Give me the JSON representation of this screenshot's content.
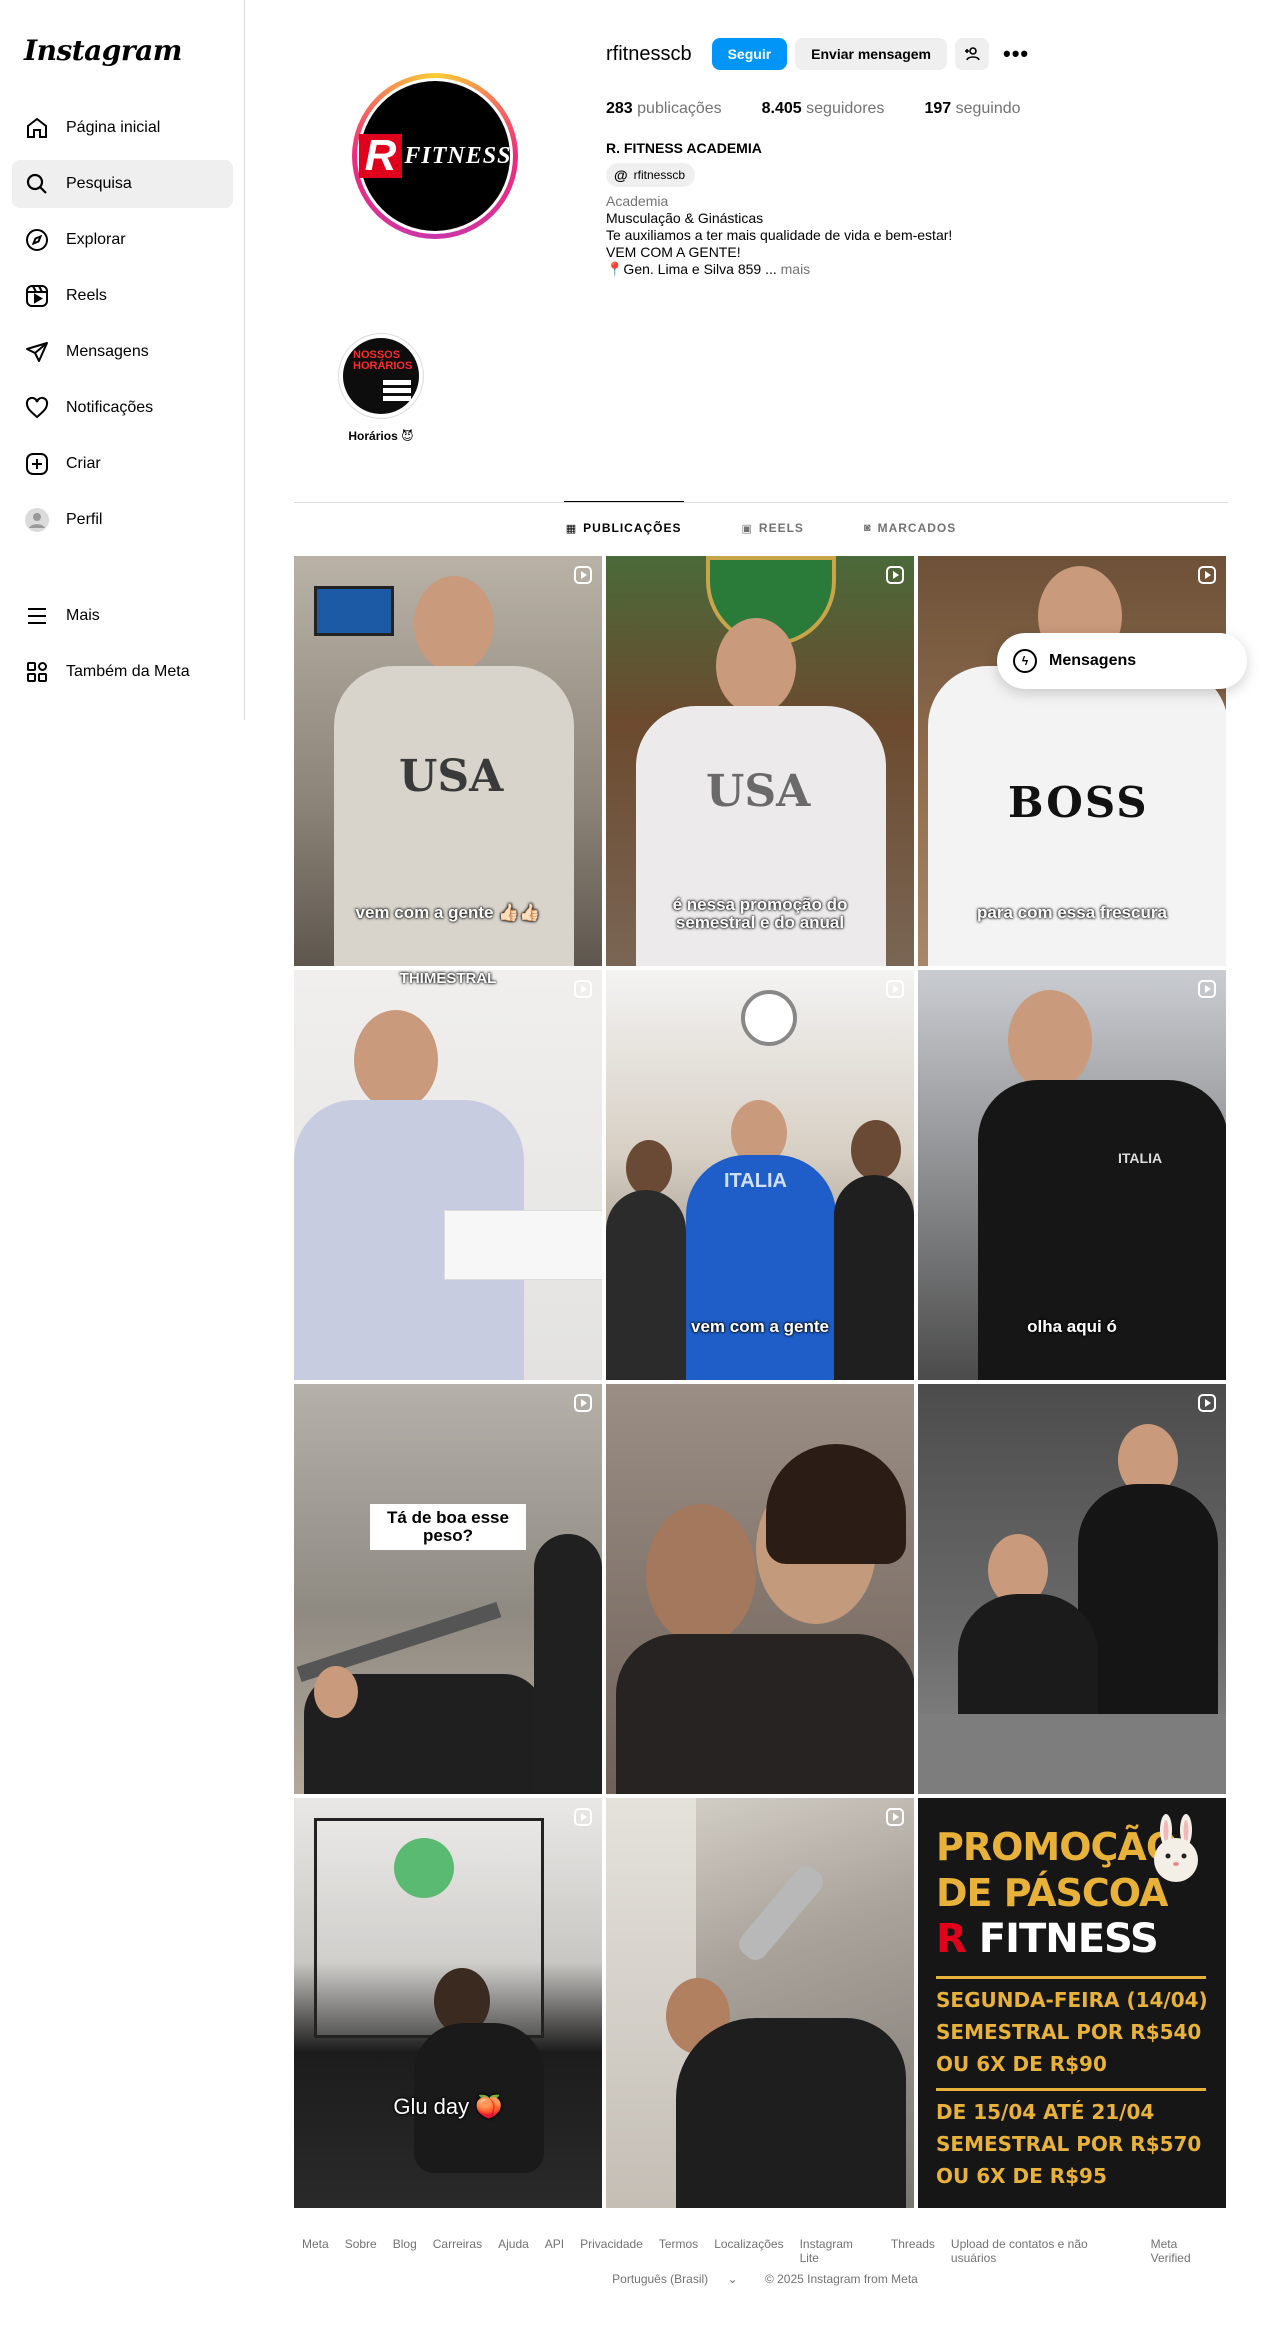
{
  "app": {
    "logo": "Instagram"
  },
  "sidebar": {
    "items": [
      {
        "label": "Página inicial",
        "icon": "home-icon"
      },
      {
        "label": "Pesquisa",
        "icon": "search-icon"
      },
      {
        "label": "Explorar",
        "icon": "compass-icon"
      },
      {
        "label": "Reels",
        "icon": "reels-icon"
      },
      {
        "label": "Mensagens",
        "icon": "paper-plane-icon"
      },
      {
        "label": "Notificações",
        "icon": "heart-icon"
      },
      {
        "label": "Criar",
        "icon": "plus-square-icon"
      },
      {
        "label": "Perfil",
        "icon": "avatar-icon"
      }
    ],
    "bottom": [
      {
        "label": "Mais",
        "icon": "menu-icon"
      },
      {
        "label": "Também da Meta",
        "icon": "meta-apps-icon"
      }
    ]
  },
  "profile": {
    "username": "rfitnesscb",
    "follow_label": "Seguir",
    "message_label": "Enviar mensagem",
    "avatar_r": "R",
    "avatar_text": "FITNESS",
    "stats": {
      "posts": "283",
      "posts_label": "publicações",
      "followers": "8.405",
      "followers_label": "seguidores",
      "following": "197",
      "following_label": "seguindo"
    },
    "full_name": "R. FITNESS ACADEMIA",
    "threads_handle": "rfitnesscb",
    "category": "Academia",
    "bio_lines": [
      "Musculação & Ginásticas",
      "Te auxiliamos a ter mais qualidade de vida e bem-estar!",
      "VEM COM A GENTE!",
      "📍Gen. Lima e Silva 859 ..."
    ],
    "more_label": "mais"
  },
  "highlight": {
    "label": "Horários 😈",
    "cover_text": "NOSSOS HORÁRIOS"
  },
  "tabs": [
    {
      "label": "PUBLICAÇÕES",
      "icon": "grid-icon"
    },
    {
      "label": "REELS",
      "icon": "reels-icon"
    },
    {
      "label": "MARCADOS",
      "icon": "tagged-icon"
    }
  ],
  "posts": [
    {
      "caption": "vem com a gente 👍🏻👍🏻",
      "shirt": "USA"
    },
    {
      "caption": "é nessa promoção do semestral e do anual",
      "shirt": "USA"
    },
    {
      "caption": "para com essa frescura",
      "shirt": "BOSS"
    },
    {
      "caption": "THIMESTRAL"
    },
    {
      "caption": "vem com a gente",
      "shirt": "ITALIA"
    },
    {
      "caption": "olha aqui ó",
      "shirt": "ITALIA"
    },
    {
      "caption": "Tá de boa esse peso?"
    },
    {
      "caption": ""
    },
    {
      "caption": ""
    },
    {
      "caption": "Glu day 🍑"
    },
    {
      "caption": ""
    }
  ],
  "promo": {
    "title1": "PROMOÇÃO",
    "title2": "DE PÁSCOA",
    "brand_r": "R",
    "brand_rest": " FITNESS",
    "block1": [
      "SEGUNDA-FEIRA (14/04)",
      "SEMESTRAL POR R$540",
      "OU 6X DE R$90"
    ],
    "block2": [
      "DE 15/04 ATÉ 21/04",
      "SEMESTRAL POR R$570",
      "OU 6X DE R$95"
    ]
  },
  "floating_messages": {
    "label": "Mensagens"
  },
  "footer": {
    "links": [
      "Meta",
      "Sobre",
      "Blog",
      "Carreiras",
      "Ajuda",
      "API",
      "Privacidade",
      "Termos",
      "Localizações",
      "Instagram Lite",
      "Threads",
      "Upload de contatos e não usuários",
      "Meta Verified"
    ],
    "language": "Português (Brasil)",
    "copyright": "© 2025 Instagram from Meta"
  },
  "colors": {
    "primary": "#0095f6",
    "promo_gold": "#e8b23a",
    "brand_red": "#e0001b"
  }
}
